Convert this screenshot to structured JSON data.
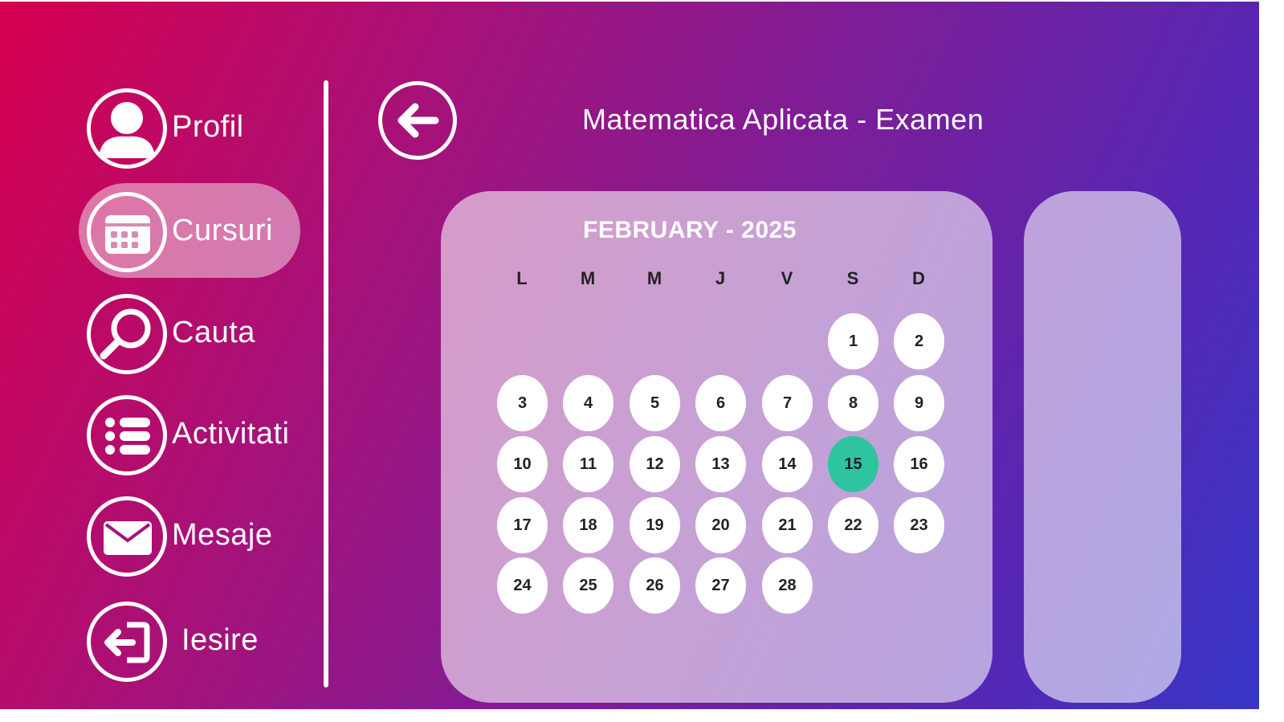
{
  "sidebar": {
    "items": [
      {
        "label": "Profil",
        "icon": "user-icon",
        "active": false
      },
      {
        "label": "Cursuri",
        "icon": "calendar-icon",
        "active": true
      },
      {
        "label": "Cauta",
        "icon": "search-icon",
        "active": false
      },
      {
        "label": "Activitati",
        "icon": "list-icon",
        "active": false
      },
      {
        "label": "Mesaje",
        "icon": "mail-icon",
        "active": false
      },
      {
        "label": "Iesire",
        "icon": "exit-icon",
        "active": false
      }
    ]
  },
  "header": {
    "back_icon": "arrow-left-icon",
    "title": "Matematica Aplicata - Examen"
  },
  "calendar": {
    "month_title": "FEBRUARY - 2025",
    "weekdays": [
      "L",
      "M",
      "M",
      "J",
      "V",
      "S",
      "D"
    ],
    "first_weekday_index": 5,
    "days": [
      "1",
      "2",
      "3",
      "4",
      "5",
      "6",
      "7",
      "8",
      "9",
      "10",
      "11",
      "12",
      "13",
      "14",
      "15",
      "16",
      "17",
      "18",
      "19",
      "20",
      "21",
      "22",
      "23",
      "24",
      "25",
      "26",
      "27",
      "28"
    ],
    "highlighted_day": "15"
  },
  "colors": {
    "gradient_start": "#d6004f",
    "gradient_end": "#3438c8",
    "highlight": "#2ec4a0",
    "card": "rgba(255,255,255,0.58)"
  }
}
